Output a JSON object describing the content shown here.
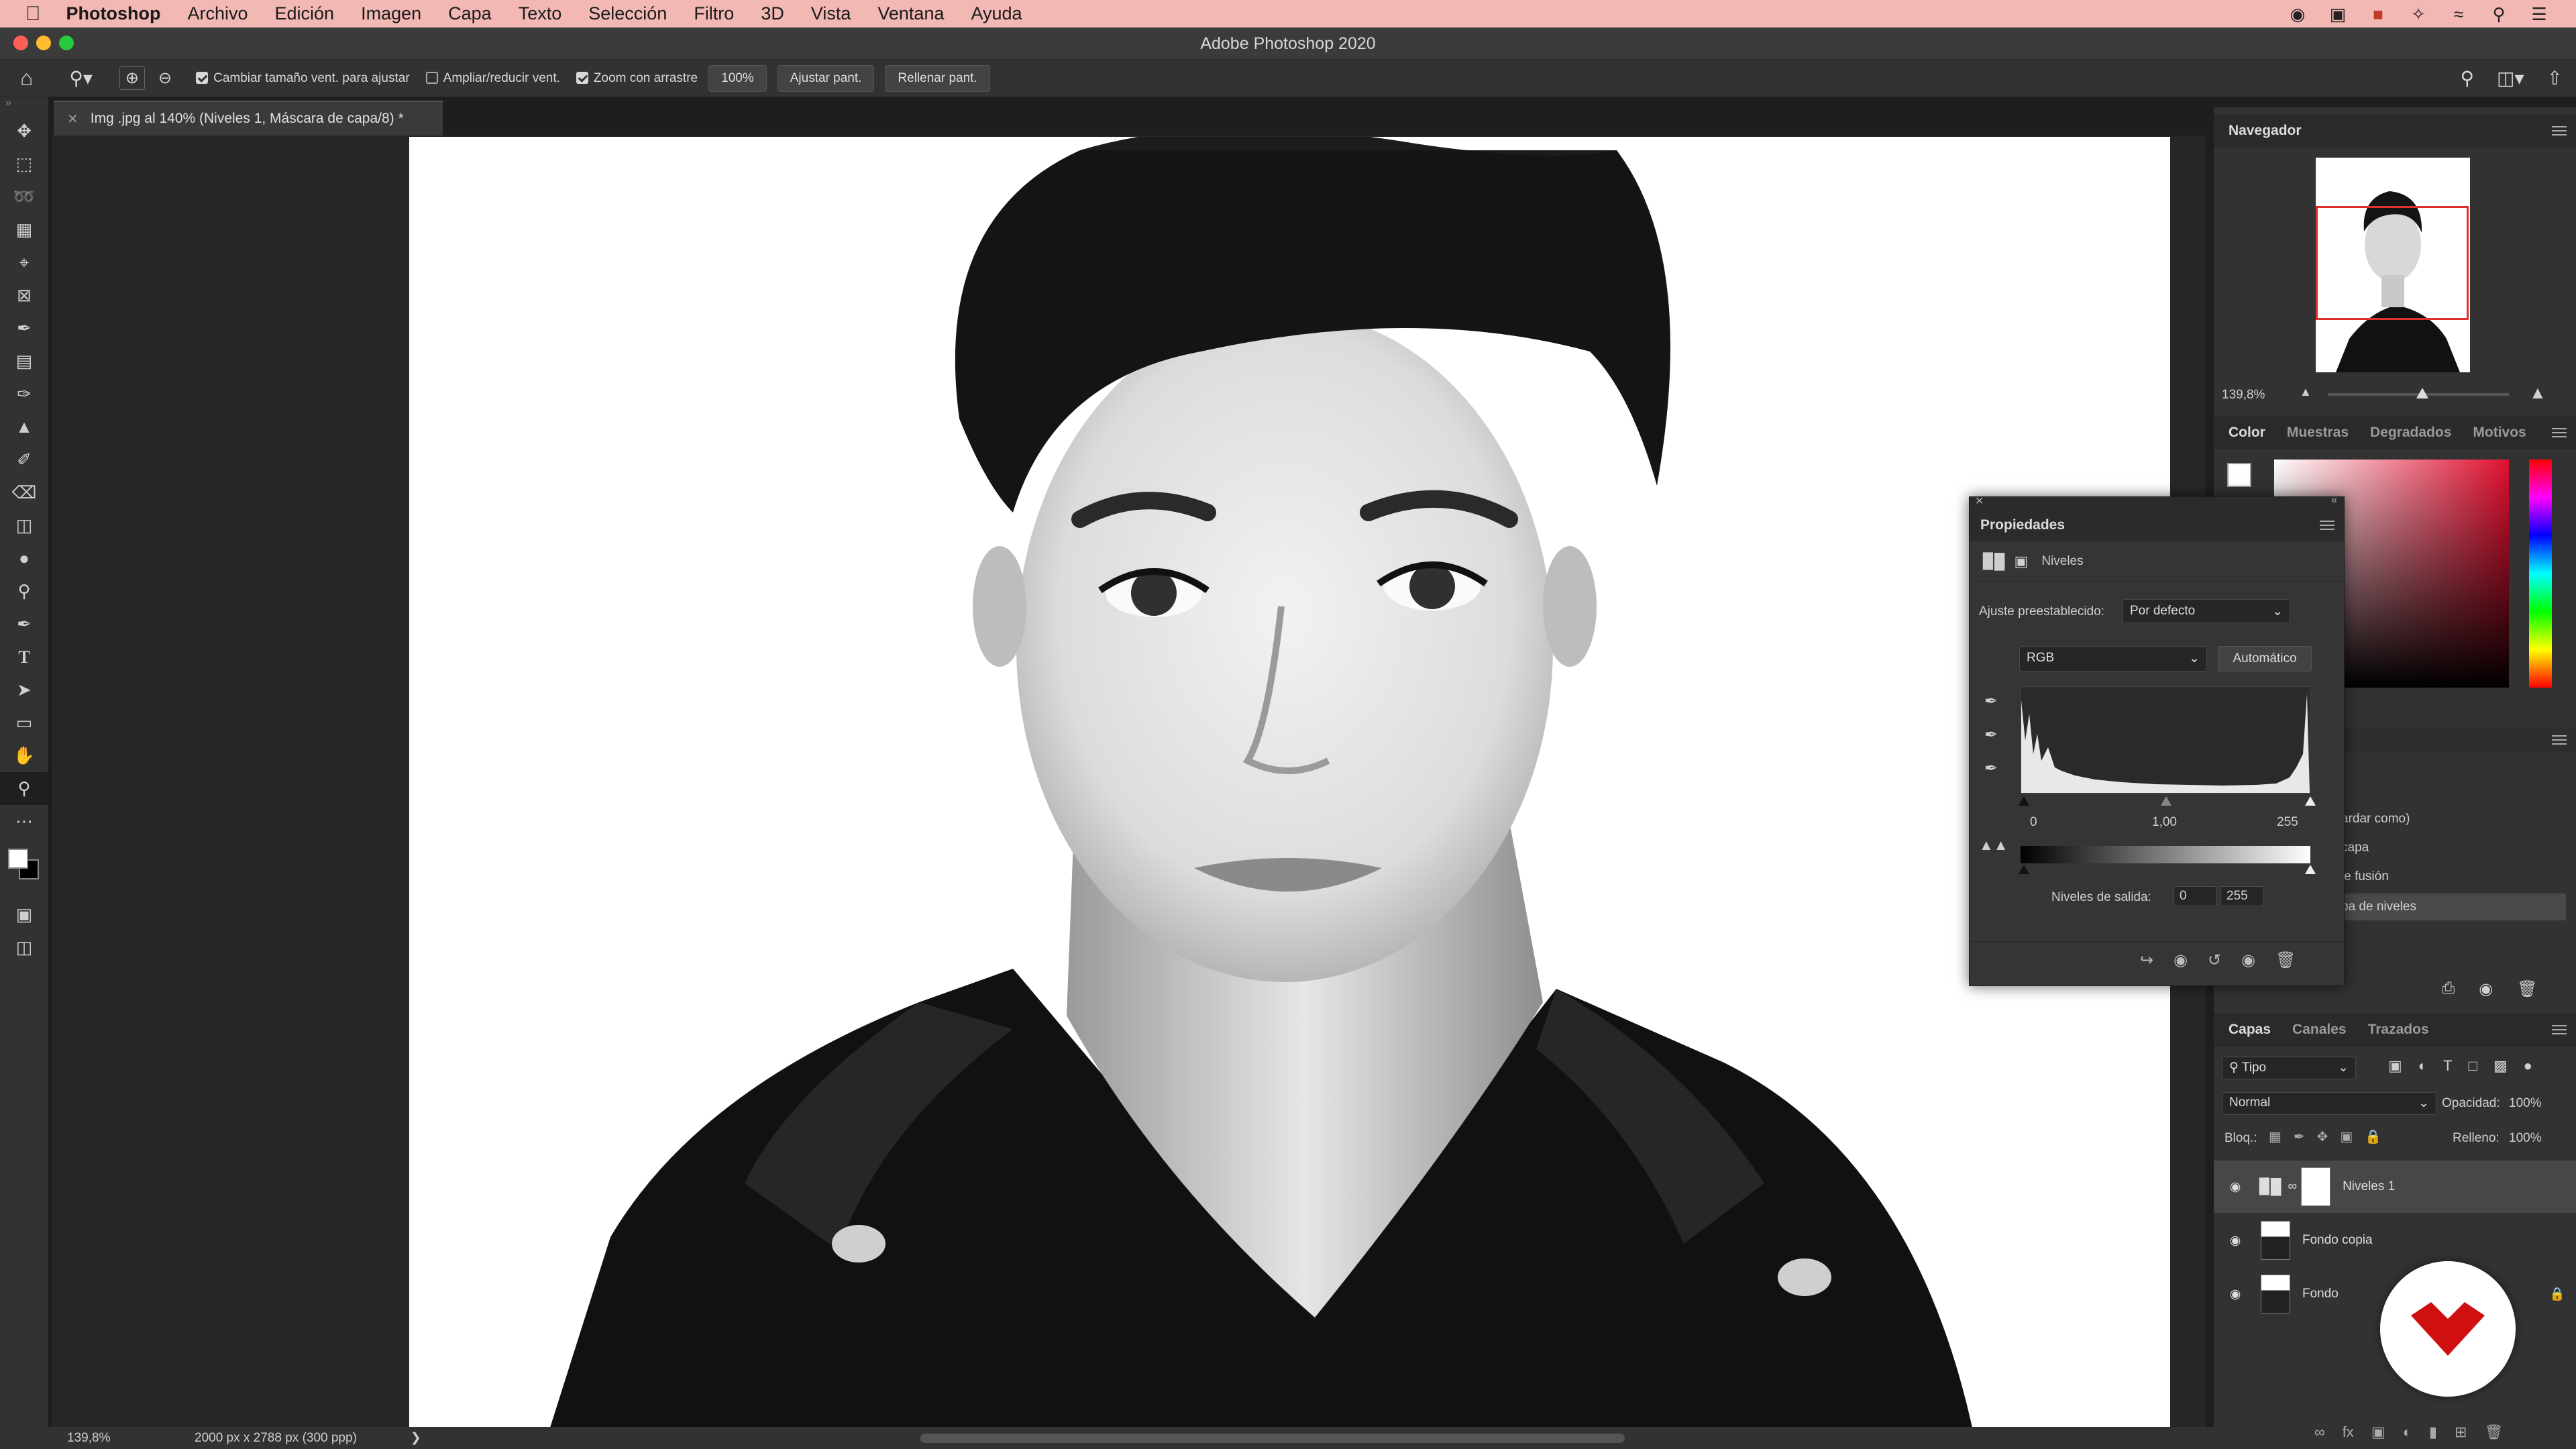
{
  "menubar": {
    "app": "Photoshop",
    "items": [
      "Archivo",
      "Edición",
      "Imagen",
      "Capa",
      "Texto",
      "Selección",
      "Filtro",
      "3D",
      "Vista",
      "Ventana",
      "Ayuda"
    ]
  },
  "window": {
    "title": "Adobe Photoshop 2020"
  },
  "options": {
    "opt1": "Cambiar tamaño vent. para ajustar",
    "opt2": "Ampliar/reducir vent.",
    "opt3": "Zoom con arrastre",
    "zoom_value": "100%",
    "fit_btn": "Ajustar pant.",
    "fill_btn": "Rellenar pant."
  },
  "document": {
    "tab": "Img .jpg al 140% (Niveles 1, Máscara de capa/8) *"
  },
  "status": {
    "zoom": "139,8%",
    "dims": "2000 px x 2788 px (300 ppp)"
  },
  "navigator": {
    "title": "Navegador",
    "zoom": "139,8%"
  },
  "color_panel": {
    "tabs": [
      "Color",
      "Muestras",
      "Degradados",
      "Motivos"
    ]
  },
  "history": {
    "items": [
      "ardar como)",
      "capa",
      "le fusión",
      "pa de niveles"
    ]
  },
  "properties": {
    "title": "Propiedades",
    "section": "Niveles",
    "preset_label": "Ajuste preestablecido:",
    "preset_value": "Por defecto",
    "channel": "RGB",
    "auto_btn": "Automático",
    "input_black": "0",
    "input_gamma": "1,00",
    "input_white": "255",
    "output_label": "Niveles de salida:",
    "output_black": "0",
    "output_white": "255"
  },
  "layers": {
    "tabs": [
      "Capas",
      "Canales",
      "Trazados"
    ],
    "filter": "Tipo",
    "blend": "Normal",
    "opacity_label": "Opacidad:",
    "opacity": "100%",
    "lock_label": "Bloq.:",
    "fill_label": "Relleno:",
    "fill": "100%",
    "items": [
      {
        "name": "Niveles 1"
      },
      {
        "name": "Fondo copia"
      },
      {
        "name": "Fondo"
      }
    ]
  }
}
